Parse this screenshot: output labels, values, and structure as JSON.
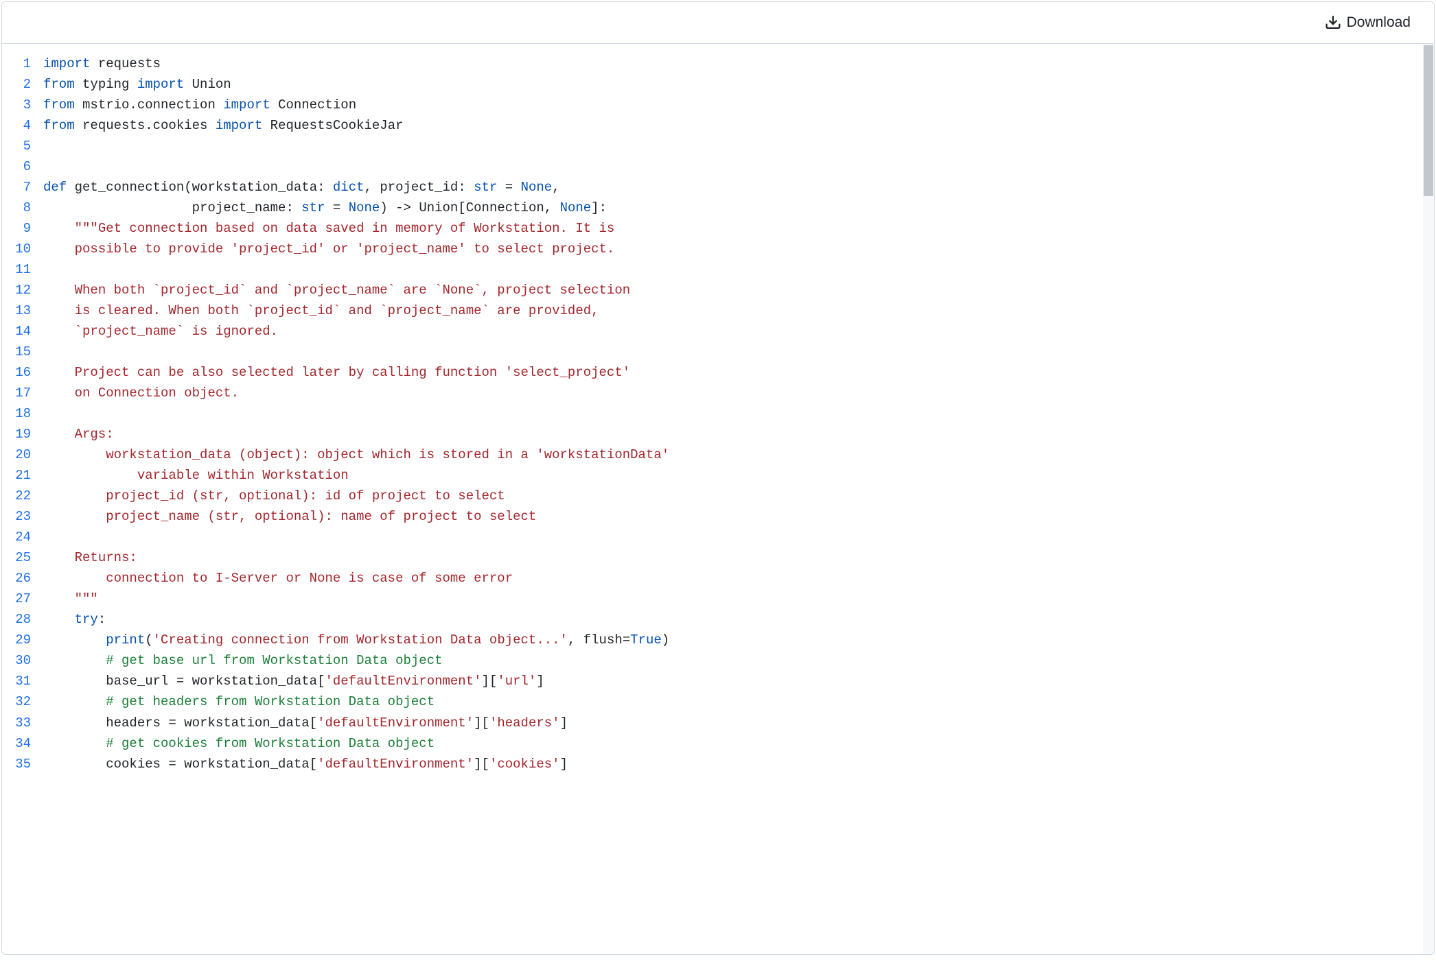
{
  "toolbar": {
    "download_label": "Download"
  },
  "code": {
    "lines": [
      {
        "n": 1,
        "tokens": [
          [
            "kw",
            "import"
          ],
          [
            "op",
            " requests"
          ]
        ]
      },
      {
        "n": 2,
        "tokens": [
          [
            "kw",
            "from"
          ],
          [
            "op",
            " typing "
          ],
          [
            "kw",
            "import"
          ],
          [
            "op",
            " Union"
          ]
        ]
      },
      {
        "n": 3,
        "tokens": [
          [
            "kw",
            "from"
          ],
          [
            "op",
            " mstrio.connection "
          ],
          [
            "kw",
            "import"
          ],
          [
            "op",
            " Connection"
          ]
        ]
      },
      {
        "n": 4,
        "tokens": [
          [
            "kw",
            "from"
          ],
          [
            "op",
            " requests.cookies "
          ],
          [
            "kw",
            "import"
          ],
          [
            "op",
            " RequestsCookieJar"
          ]
        ]
      },
      {
        "n": 5,
        "tokens": []
      },
      {
        "n": 6,
        "tokens": []
      },
      {
        "n": 7,
        "tokens": [
          [
            "kw",
            "def"
          ],
          [
            "op",
            " "
          ],
          [
            "fn",
            "get_connection"
          ],
          [
            "op",
            "(workstation_data: "
          ],
          [
            "bi",
            "dict"
          ],
          [
            "op",
            ", project_id: "
          ],
          [
            "bi",
            "str"
          ],
          [
            "op",
            " = "
          ],
          [
            "cn",
            "None"
          ],
          [
            "op",
            ","
          ]
        ]
      },
      {
        "n": 8,
        "tokens": [
          [
            "op",
            "                   project_name: "
          ],
          [
            "bi",
            "str"
          ],
          [
            "op",
            " = "
          ],
          [
            "cn",
            "None"
          ],
          [
            "op",
            ") -> Union[Connection, "
          ],
          [
            "cn",
            "None"
          ],
          [
            "op",
            "]:"
          ]
        ]
      },
      {
        "n": 9,
        "tokens": [
          [
            "op",
            "    "
          ],
          [
            "st",
            "\"\"\"Get connection based on data saved in memory of Workstation. It is"
          ]
        ]
      },
      {
        "n": 10,
        "tokens": [
          [
            "st",
            "    possible to provide 'project_id' or 'project_name' to select project."
          ]
        ]
      },
      {
        "n": 11,
        "tokens": []
      },
      {
        "n": 12,
        "tokens": [
          [
            "st",
            "    When both `project_id` and `project_name` are `None`, project selection"
          ]
        ]
      },
      {
        "n": 13,
        "tokens": [
          [
            "st",
            "    is cleared. When both `project_id` and `project_name` are provided,"
          ]
        ]
      },
      {
        "n": 14,
        "tokens": [
          [
            "st",
            "    `project_name` is ignored."
          ]
        ]
      },
      {
        "n": 15,
        "tokens": []
      },
      {
        "n": 16,
        "tokens": [
          [
            "st",
            "    Project can be also selected later by calling function 'select_project'"
          ]
        ]
      },
      {
        "n": 17,
        "tokens": [
          [
            "st",
            "    on Connection object."
          ]
        ]
      },
      {
        "n": 18,
        "tokens": []
      },
      {
        "n": 19,
        "tokens": [
          [
            "st",
            "    Args:"
          ]
        ]
      },
      {
        "n": 20,
        "tokens": [
          [
            "st",
            "        workstation_data (object): object which is stored in a 'workstationData'"
          ]
        ]
      },
      {
        "n": 21,
        "tokens": [
          [
            "st",
            "            variable within Workstation"
          ]
        ]
      },
      {
        "n": 22,
        "tokens": [
          [
            "st",
            "        project_id (str, optional): id of project to select"
          ]
        ]
      },
      {
        "n": 23,
        "tokens": [
          [
            "st",
            "        project_name (str, optional): name of project to select"
          ]
        ]
      },
      {
        "n": 24,
        "tokens": []
      },
      {
        "n": 25,
        "tokens": [
          [
            "st",
            "    Returns:"
          ]
        ]
      },
      {
        "n": 26,
        "tokens": [
          [
            "st",
            "        connection to I-Server or None is case of some error"
          ]
        ]
      },
      {
        "n": 27,
        "tokens": [
          [
            "op",
            "    "
          ],
          [
            "st",
            "\"\"\""
          ]
        ]
      },
      {
        "n": 28,
        "tokens": [
          [
            "op",
            "    "
          ],
          [
            "kw",
            "try"
          ],
          [
            "op",
            ":"
          ]
        ]
      },
      {
        "n": 29,
        "tokens": [
          [
            "op",
            "        "
          ],
          [
            "bi",
            "print"
          ],
          [
            "op",
            "("
          ],
          [
            "st",
            "'Creating connection from Workstation Data object...'"
          ],
          [
            "op",
            ", flush="
          ],
          [
            "cn",
            "True"
          ],
          [
            "op",
            ")"
          ]
        ]
      },
      {
        "n": 30,
        "tokens": [
          [
            "op",
            "        "
          ],
          [
            "cm",
            "# get base url from Workstation Data object"
          ]
        ]
      },
      {
        "n": 31,
        "tokens": [
          [
            "op",
            "        base_url = workstation_data["
          ],
          [
            "st",
            "'defaultEnvironment'"
          ],
          [
            "op",
            "]["
          ],
          [
            "st",
            "'url'"
          ],
          [
            "op",
            "]"
          ]
        ]
      },
      {
        "n": 32,
        "tokens": [
          [
            "op",
            "        "
          ],
          [
            "cm",
            "# get headers from Workstation Data object"
          ]
        ]
      },
      {
        "n": 33,
        "tokens": [
          [
            "op",
            "        headers = workstation_data["
          ],
          [
            "st",
            "'defaultEnvironment'"
          ],
          [
            "op",
            "]["
          ],
          [
            "st",
            "'headers'"
          ],
          [
            "op",
            "]"
          ]
        ]
      },
      {
        "n": 34,
        "tokens": [
          [
            "op",
            "        "
          ],
          [
            "cm",
            "# get cookies from Workstation Data object"
          ]
        ]
      },
      {
        "n": 35,
        "tokens": [
          [
            "op",
            "        cookies = workstation_data["
          ],
          [
            "st",
            "'defaultEnvironment'"
          ],
          [
            "op",
            "]["
          ],
          [
            "st",
            "'cookies'"
          ],
          [
            "op",
            "]"
          ]
        ]
      }
    ]
  }
}
